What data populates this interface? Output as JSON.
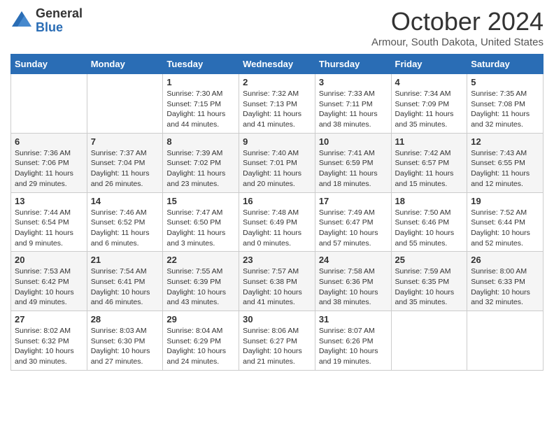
{
  "header": {
    "logo_general": "General",
    "logo_blue": "Blue",
    "title": "October 2024",
    "location": "Armour, South Dakota, United States"
  },
  "weekdays": [
    "Sunday",
    "Monday",
    "Tuesday",
    "Wednesday",
    "Thursday",
    "Friday",
    "Saturday"
  ],
  "weeks": [
    [
      {
        "day": "",
        "info": ""
      },
      {
        "day": "",
        "info": ""
      },
      {
        "day": "1",
        "info": "Sunrise: 7:30 AM\nSunset: 7:15 PM\nDaylight: 11 hours and 44 minutes."
      },
      {
        "day": "2",
        "info": "Sunrise: 7:32 AM\nSunset: 7:13 PM\nDaylight: 11 hours and 41 minutes."
      },
      {
        "day": "3",
        "info": "Sunrise: 7:33 AM\nSunset: 7:11 PM\nDaylight: 11 hours and 38 minutes."
      },
      {
        "day": "4",
        "info": "Sunrise: 7:34 AM\nSunset: 7:09 PM\nDaylight: 11 hours and 35 minutes."
      },
      {
        "day": "5",
        "info": "Sunrise: 7:35 AM\nSunset: 7:08 PM\nDaylight: 11 hours and 32 minutes."
      }
    ],
    [
      {
        "day": "6",
        "info": "Sunrise: 7:36 AM\nSunset: 7:06 PM\nDaylight: 11 hours and 29 minutes."
      },
      {
        "day": "7",
        "info": "Sunrise: 7:37 AM\nSunset: 7:04 PM\nDaylight: 11 hours and 26 minutes."
      },
      {
        "day": "8",
        "info": "Sunrise: 7:39 AM\nSunset: 7:02 PM\nDaylight: 11 hours and 23 minutes."
      },
      {
        "day": "9",
        "info": "Sunrise: 7:40 AM\nSunset: 7:01 PM\nDaylight: 11 hours and 20 minutes."
      },
      {
        "day": "10",
        "info": "Sunrise: 7:41 AM\nSunset: 6:59 PM\nDaylight: 11 hours and 18 minutes."
      },
      {
        "day": "11",
        "info": "Sunrise: 7:42 AM\nSunset: 6:57 PM\nDaylight: 11 hours and 15 minutes."
      },
      {
        "day": "12",
        "info": "Sunrise: 7:43 AM\nSunset: 6:55 PM\nDaylight: 11 hours and 12 minutes."
      }
    ],
    [
      {
        "day": "13",
        "info": "Sunrise: 7:44 AM\nSunset: 6:54 PM\nDaylight: 11 hours and 9 minutes."
      },
      {
        "day": "14",
        "info": "Sunrise: 7:46 AM\nSunset: 6:52 PM\nDaylight: 11 hours and 6 minutes."
      },
      {
        "day": "15",
        "info": "Sunrise: 7:47 AM\nSunset: 6:50 PM\nDaylight: 11 hours and 3 minutes."
      },
      {
        "day": "16",
        "info": "Sunrise: 7:48 AM\nSunset: 6:49 PM\nDaylight: 11 hours and 0 minutes."
      },
      {
        "day": "17",
        "info": "Sunrise: 7:49 AM\nSunset: 6:47 PM\nDaylight: 10 hours and 57 minutes."
      },
      {
        "day": "18",
        "info": "Sunrise: 7:50 AM\nSunset: 6:46 PM\nDaylight: 10 hours and 55 minutes."
      },
      {
        "day": "19",
        "info": "Sunrise: 7:52 AM\nSunset: 6:44 PM\nDaylight: 10 hours and 52 minutes."
      }
    ],
    [
      {
        "day": "20",
        "info": "Sunrise: 7:53 AM\nSunset: 6:42 PM\nDaylight: 10 hours and 49 minutes."
      },
      {
        "day": "21",
        "info": "Sunrise: 7:54 AM\nSunset: 6:41 PM\nDaylight: 10 hours and 46 minutes."
      },
      {
        "day": "22",
        "info": "Sunrise: 7:55 AM\nSunset: 6:39 PM\nDaylight: 10 hours and 43 minutes."
      },
      {
        "day": "23",
        "info": "Sunrise: 7:57 AM\nSunset: 6:38 PM\nDaylight: 10 hours and 41 minutes."
      },
      {
        "day": "24",
        "info": "Sunrise: 7:58 AM\nSunset: 6:36 PM\nDaylight: 10 hours and 38 minutes."
      },
      {
        "day": "25",
        "info": "Sunrise: 7:59 AM\nSunset: 6:35 PM\nDaylight: 10 hours and 35 minutes."
      },
      {
        "day": "26",
        "info": "Sunrise: 8:00 AM\nSunset: 6:33 PM\nDaylight: 10 hours and 32 minutes."
      }
    ],
    [
      {
        "day": "27",
        "info": "Sunrise: 8:02 AM\nSunset: 6:32 PM\nDaylight: 10 hours and 30 minutes."
      },
      {
        "day": "28",
        "info": "Sunrise: 8:03 AM\nSunset: 6:30 PM\nDaylight: 10 hours and 27 minutes."
      },
      {
        "day": "29",
        "info": "Sunrise: 8:04 AM\nSunset: 6:29 PM\nDaylight: 10 hours and 24 minutes."
      },
      {
        "day": "30",
        "info": "Sunrise: 8:06 AM\nSunset: 6:27 PM\nDaylight: 10 hours and 21 minutes."
      },
      {
        "day": "31",
        "info": "Sunrise: 8:07 AM\nSunset: 6:26 PM\nDaylight: 10 hours and 19 minutes."
      },
      {
        "day": "",
        "info": ""
      },
      {
        "day": "",
        "info": ""
      }
    ]
  ]
}
